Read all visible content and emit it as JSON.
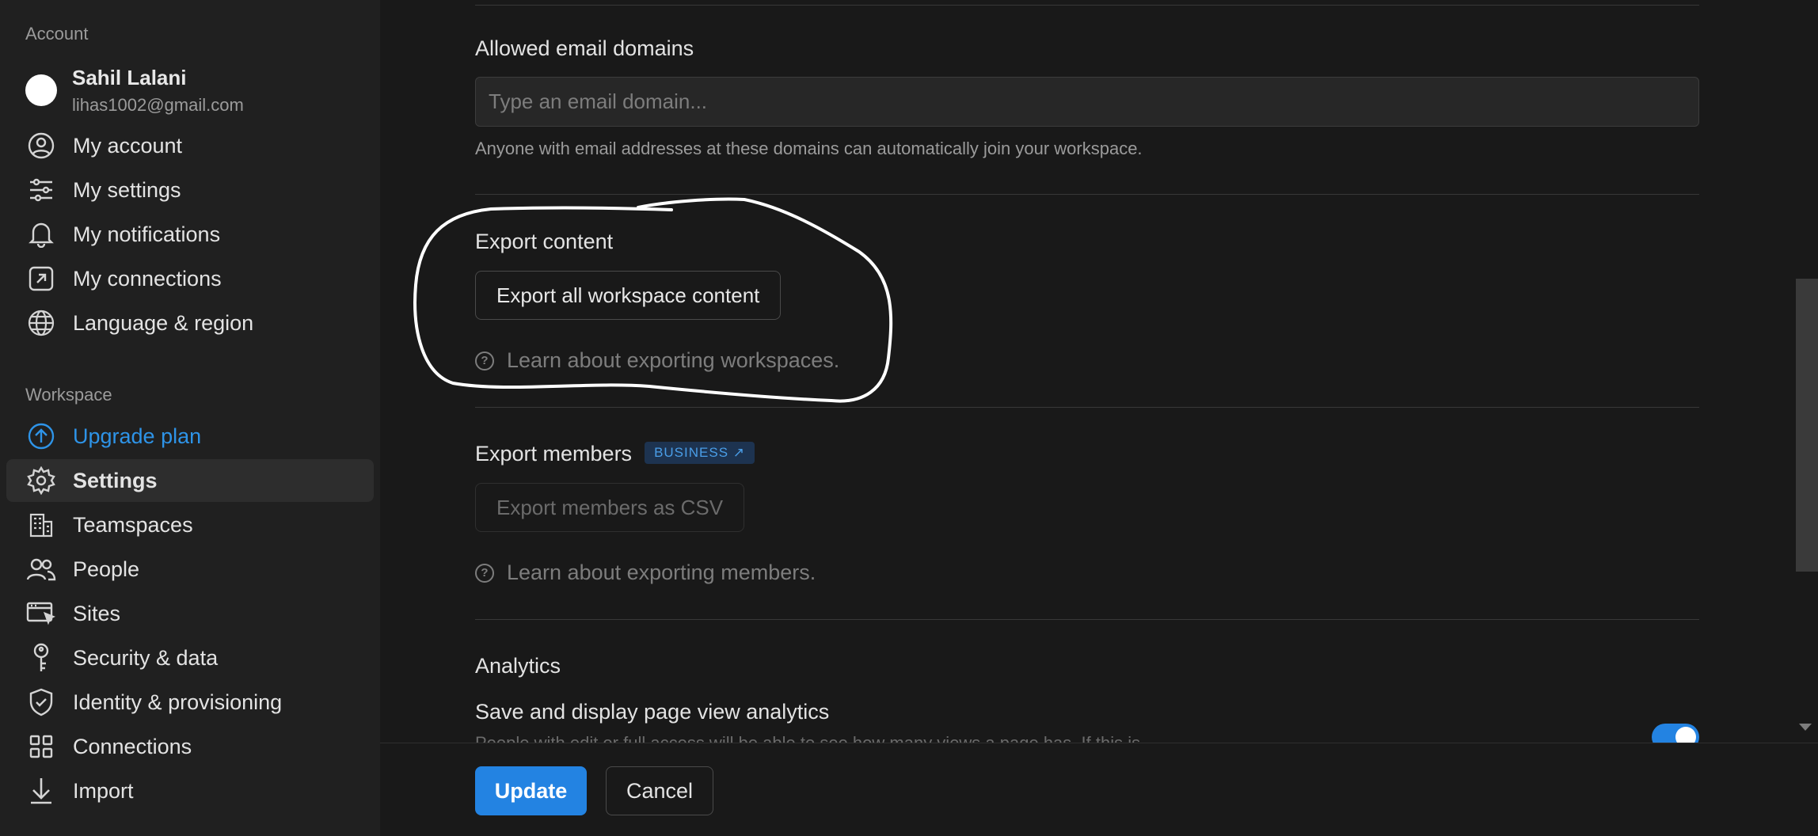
{
  "sidebar": {
    "account_label": "Account",
    "profile": {
      "name": "Sahil Lalani",
      "email": "lihas1002@gmail.com"
    },
    "account_items": [
      {
        "label": "My account",
        "icon": "user-circle-icon"
      },
      {
        "label": "My settings",
        "icon": "sliders-icon"
      },
      {
        "label": "My notifications",
        "icon": "bell-icon"
      },
      {
        "label": "My connections",
        "icon": "external-link-icon"
      },
      {
        "label": "Language & region",
        "icon": "globe-icon"
      }
    ],
    "workspace_label": "Workspace",
    "workspace_items": [
      {
        "label": "Upgrade plan",
        "icon": "arrow-up-circle-icon"
      },
      {
        "label": "Settings",
        "icon": "gear-icon"
      },
      {
        "label": "Teamspaces",
        "icon": "building-icon"
      },
      {
        "label": "People",
        "icon": "people-icon"
      },
      {
        "label": "Sites",
        "icon": "browser-cursor-icon"
      },
      {
        "label": "Security & data",
        "icon": "key-icon"
      },
      {
        "label": "Identity & provisioning",
        "icon": "shield-check-icon"
      },
      {
        "label": "Connections",
        "icon": "grid-icon"
      },
      {
        "label": "Import",
        "icon": "download-icon"
      }
    ]
  },
  "main": {
    "allowed_domains": {
      "title": "Allowed email domains",
      "placeholder": "Type an email domain...",
      "help": "Anyone with email addresses at these domains can automatically join your workspace."
    },
    "export_content": {
      "title": "Export content",
      "button": "Export all workspace content",
      "learn": "Learn about exporting workspaces."
    },
    "export_members": {
      "title": "Export members",
      "badge": "BUSINESS ↗",
      "button": "Export members as CSV",
      "learn": "Learn about exporting members."
    },
    "analytics": {
      "title": "Analytics",
      "setting": "Save and display page view analytics",
      "description": "People with edit or full access will be able to see how many views a page has. If this is",
      "toggle_on": true
    }
  },
  "footer": {
    "update": "Update",
    "cancel": "Cancel"
  },
  "colors": {
    "accent": "#2383e2",
    "upgrade": "#2e94e8",
    "badge_bg": "#1d3350"
  }
}
